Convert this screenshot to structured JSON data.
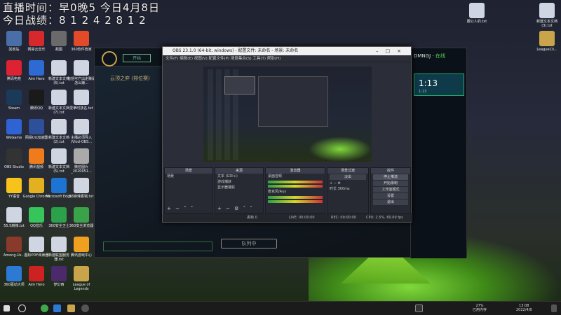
{
  "overlay": {
    "line1": "直播时间：早0晚5 今日4月8日",
    "line2": "今日战绩：8 1 2 4 2 8 1 2"
  },
  "desktop_left": [
    {
      "label": "回收站",
      "color": "#4a6ea8"
    },
    {
      "label": "网易云音乐",
      "color": "#d7282b"
    },
    {
      "label": "截图",
      "color": "#6a6a6a"
    },
    {
      "label": "360软件管家",
      "color": "#e24a2a"
    },
    {
      "label": "腾讯电竞",
      "color": "#d23"
    },
    {
      "label": "Aim Hero",
      "color": "#2d6ad4"
    },
    {
      "label": "新建文本文档(6).txt",
      "color": "#cfd6e2"
    },
    {
      "label": "包括可产出走赚是怎么赚...",
      "color": "#cfd6e2"
    },
    {
      "label": "Steam",
      "color": "#1b3a5a"
    },
    {
      "label": "腾讯QQ",
      "color": "#1a1a1a"
    },
    {
      "label": "新建文本文档(7).txt",
      "color": "#cfd6e2"
    },
    {
      "label": "爱拳时技名.txt",
      "color": "#cfd6e2"
    },
    {
      "label": "WeGame",
      "color": "#2f63d3"
    },
    {
      "label": "网易UU加速器",
      "color": "#2e4f9a"
    },
    {
      "label": "新建文本文档(2).txt",
      "color": "#cfd6e2"
    },
    {
      "label": "主播必须导入(Vlod-OBS...",
      "color": "#cfd6e2"
    },
    {
      "label": "OBS Studio",
      "color": "#333"
    },
    {
      "label": "腾讯视频",
      "color": "#ef7b1c"
    },
    {
      "label": "新建文本文档(5).txt",
      "color": "#cfd6e2"
    },
    {
      "label": "微信图片_2020051...",
      "color": "#aaa"
    },
    {
      "label": "YY语音",
      "color": "#f6c21b"
    },
    {
      "label": "Google Chrome",
      "color": "#e3b020"
    },
    {
      "label": "Microsoft Edge",
      "color": "#1d74d3"
    },
    {
      "label": "53麻辣香锅.txt",
      "color": "#cfd6e2"
    },
    {
      "label": "55.5麻辣.txt",
      "color": "#cfd6e2"
    },
    {
      "label": "QQ音乐",
      "color": "#35c55a"
    },
    {
      "label": "360安全卫士",
      "color": "#2aa14a"
    },
    {
      "label": "360安全浏览器",
      "color": "#3aa34a"
    },
    {
      "label": "Among.Us...",
      "color": "#8a3a2a"
    },
    {
      "label": "图标PDF阅读器",
      "color": "#cfd6e2"
    },
    {
      "label": "新建联盟服务器.txt",
      "color": "#cfd6e2"
    },
    {
      "label": "腾讯游戏中心",
      "color": "#f0a020"
    },
    {
      "label": "360驱动大师",
      "color": "#2d7ad4"
    },
    {
      "label": "Aim Hero",
      "color": "#c22"
    },
    {
      "label": "梦幻西",
      "color": "#4a2a6a"
    },
    {
      "label": "League of Legends",
      "color": "#c9a44b"
    }
  ],
  "desktop_right": [
    {
      "label": "跟公人的.txt",
      "color": "#cfd6e2"
    },
    {
      "label": "新建文本文档(3).txt",
      "color": "#cfd6e2"
    },
    {
      "label": "LeagueCli...",
      "color": "#c9a44b"
    }
  ],
  "client": {
    "play_label": "开始",
    "section_title": "云顶之弈 (排位赛)",
    "queue_label": "队列中",
    "username": "DMNGJ",
    "status": "在线",
    "timer": "1:13",
    "timer_sub": "1:13"
  },
  "obs": {
    "title": "OBS 23.1.0 (64-bit, windows) - 配置文件: 未命名 - 场景: 未命名",
    "menu": "文件(F)   编辑(E)   视图(V)   配置文件(P)   场景集合(S)   工具(T)   帮助(H)",
    "panels": {
      "scenes": {
        "title": "场景",
        "items": [
          "场景"
        ]
      },
      "sources": {
        "title": "来源",
        "items": [
          "文本 (GDI+)",
          "游戏捕获",
          "显示器捕获"
        ]
      },
      "mixer": {
        "title": "混音器",
        "items": [
          "桌面音频",
          "麦克风/Aux"
        ]
      },
      "transitions": {
        "title": "场景过渡",
        "fade": "淡出",
        "duration_label": "时长",
        "duration": "300ms"
      },
      "controls": {
        "title": "控件",
        "buttons": [
          "停止推流",
          "开始录制",
          "工作室模式",
          "设置",
          "退出"
        ]
      }
    },
    "status": {
      "live": "LIVE: 00:00:00",
      "rec": "REC: 00:00:00",
      "cpu": "CPU: 2.5%, 60.00 fps",
      "drop": "丢帧 0"
    }
  },
  "taskbar": {
    "temp": "27%",
    "temp_sub": "已用内存",
    "time": "13:08",
    "date": "2022/4/8"
  }
}
